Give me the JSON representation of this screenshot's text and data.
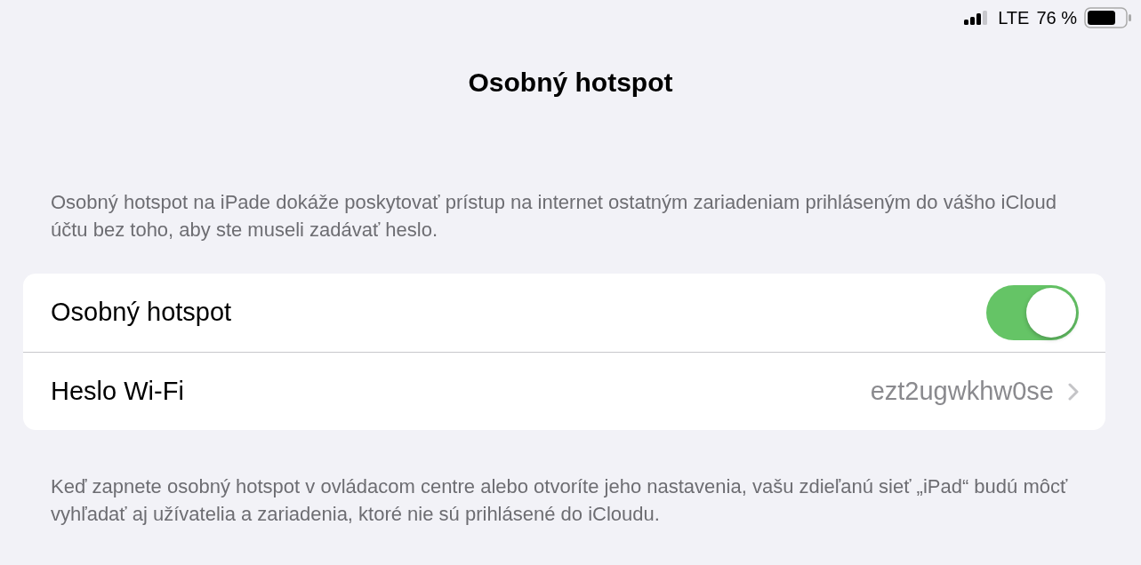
{
  "status_bar": {
    "network": "LTE",
    "battery": "76 %"
  },
  "title": "Osobný hotspot",
  "header_note": "Osobný hotspot na iPade dokáže poskytovať prístup na internet ostatným zariadeniam prihláseným do vášho iCloud účtu bez toho, aby ste museli zadávať heslo.",
  "rows": [
    {
      "kind": "toggle",
      "label": "Osobný hotspot",
      "on": true
    },
    {
      "kind": "link",
      "label": "Heslo Wi-Fi",
      "value": "ezt2ugwkhw0se"
    }
  ],
  "footer_note": "Keď zapnete osobný hotspot v ovládacom centre alebo otvoríte jeho nastavenia, vašu zdieľanú sieť „iPad“ budú môcť vyhľadať aj užívatelia a zariadenia, ktoré nie sú prihlásené do iCloudu."
}
